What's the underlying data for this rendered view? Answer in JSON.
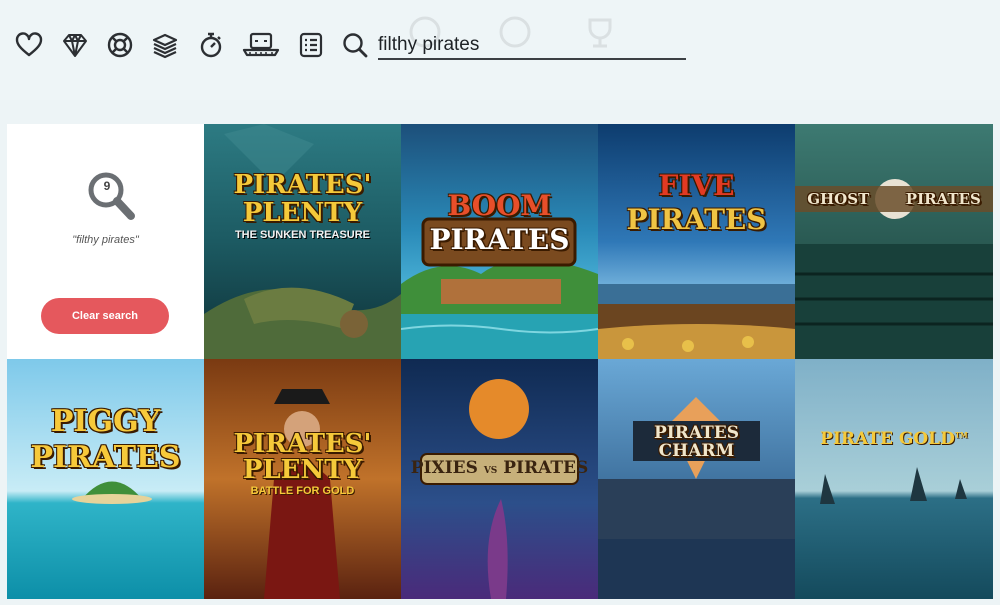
{
  "toolbar": {
    "icons": [
      "heart-icon",
      "diamond-icon",
      "lifebuoy-icon",
      "chip-stack-icon",
      "stopwatch-icon",
      "dealer-hat-icon",
      "list-icon",
      "search-icon"
    ],
    "search_value": "filthy pirates"
  },
  "results": {
    "count": "9",
    "query_label": "\"filthy pirates\"",
    "clear_label": "Clear search"
  },
  "games": [
    {
      "id": "pirates-plenty-sunken",
      "title": "PIRATES'",
      "title2": "PLENTY",
      "subtitle": "THE SUNKEN TREASURE"
    },
    {
      "id": "boom-pirates",
      "title": "BOOM",
      "title2": "PIRATES",
      "subtitle": ""
    },
    {
      "id": "five-pirates",
      "title": "FIVE",
      "title2": "PIRATES",
      "subtitle": ""
    },
    {
      "id": "ghost-pirates",
      "title": "GHOST",
      "title2": "PIRATES",
      "subtitle": ""
    },
    {
      "id": "piggy-pirates",
      "title": "PIGGY",
      "title2": "PIRATES",
      "subtitle": ""
    },
    {
      "id": "pirates-plenty-battle",
      "title": "PIRATES'",
      "title2": "PLENTY",
      "subtitle": "BATTLE FOR GOLD"
    },
    {
      "id": "pixies-vs-pirates",
      "title": "PIXIES",
      "title2": "PIRATES",
      "subtitle": "VS"
    },
    {
      "id": "pirates-charm",
      "title": "PIRATES",
      "title2": "CHARM",
      "subtitle": ""
    },
    {
      "id": "pirate-gold",
      "title": "PIRATE GOLD",
      "title2": "",
      "subtitle": "TM"
    }
  ]
}
